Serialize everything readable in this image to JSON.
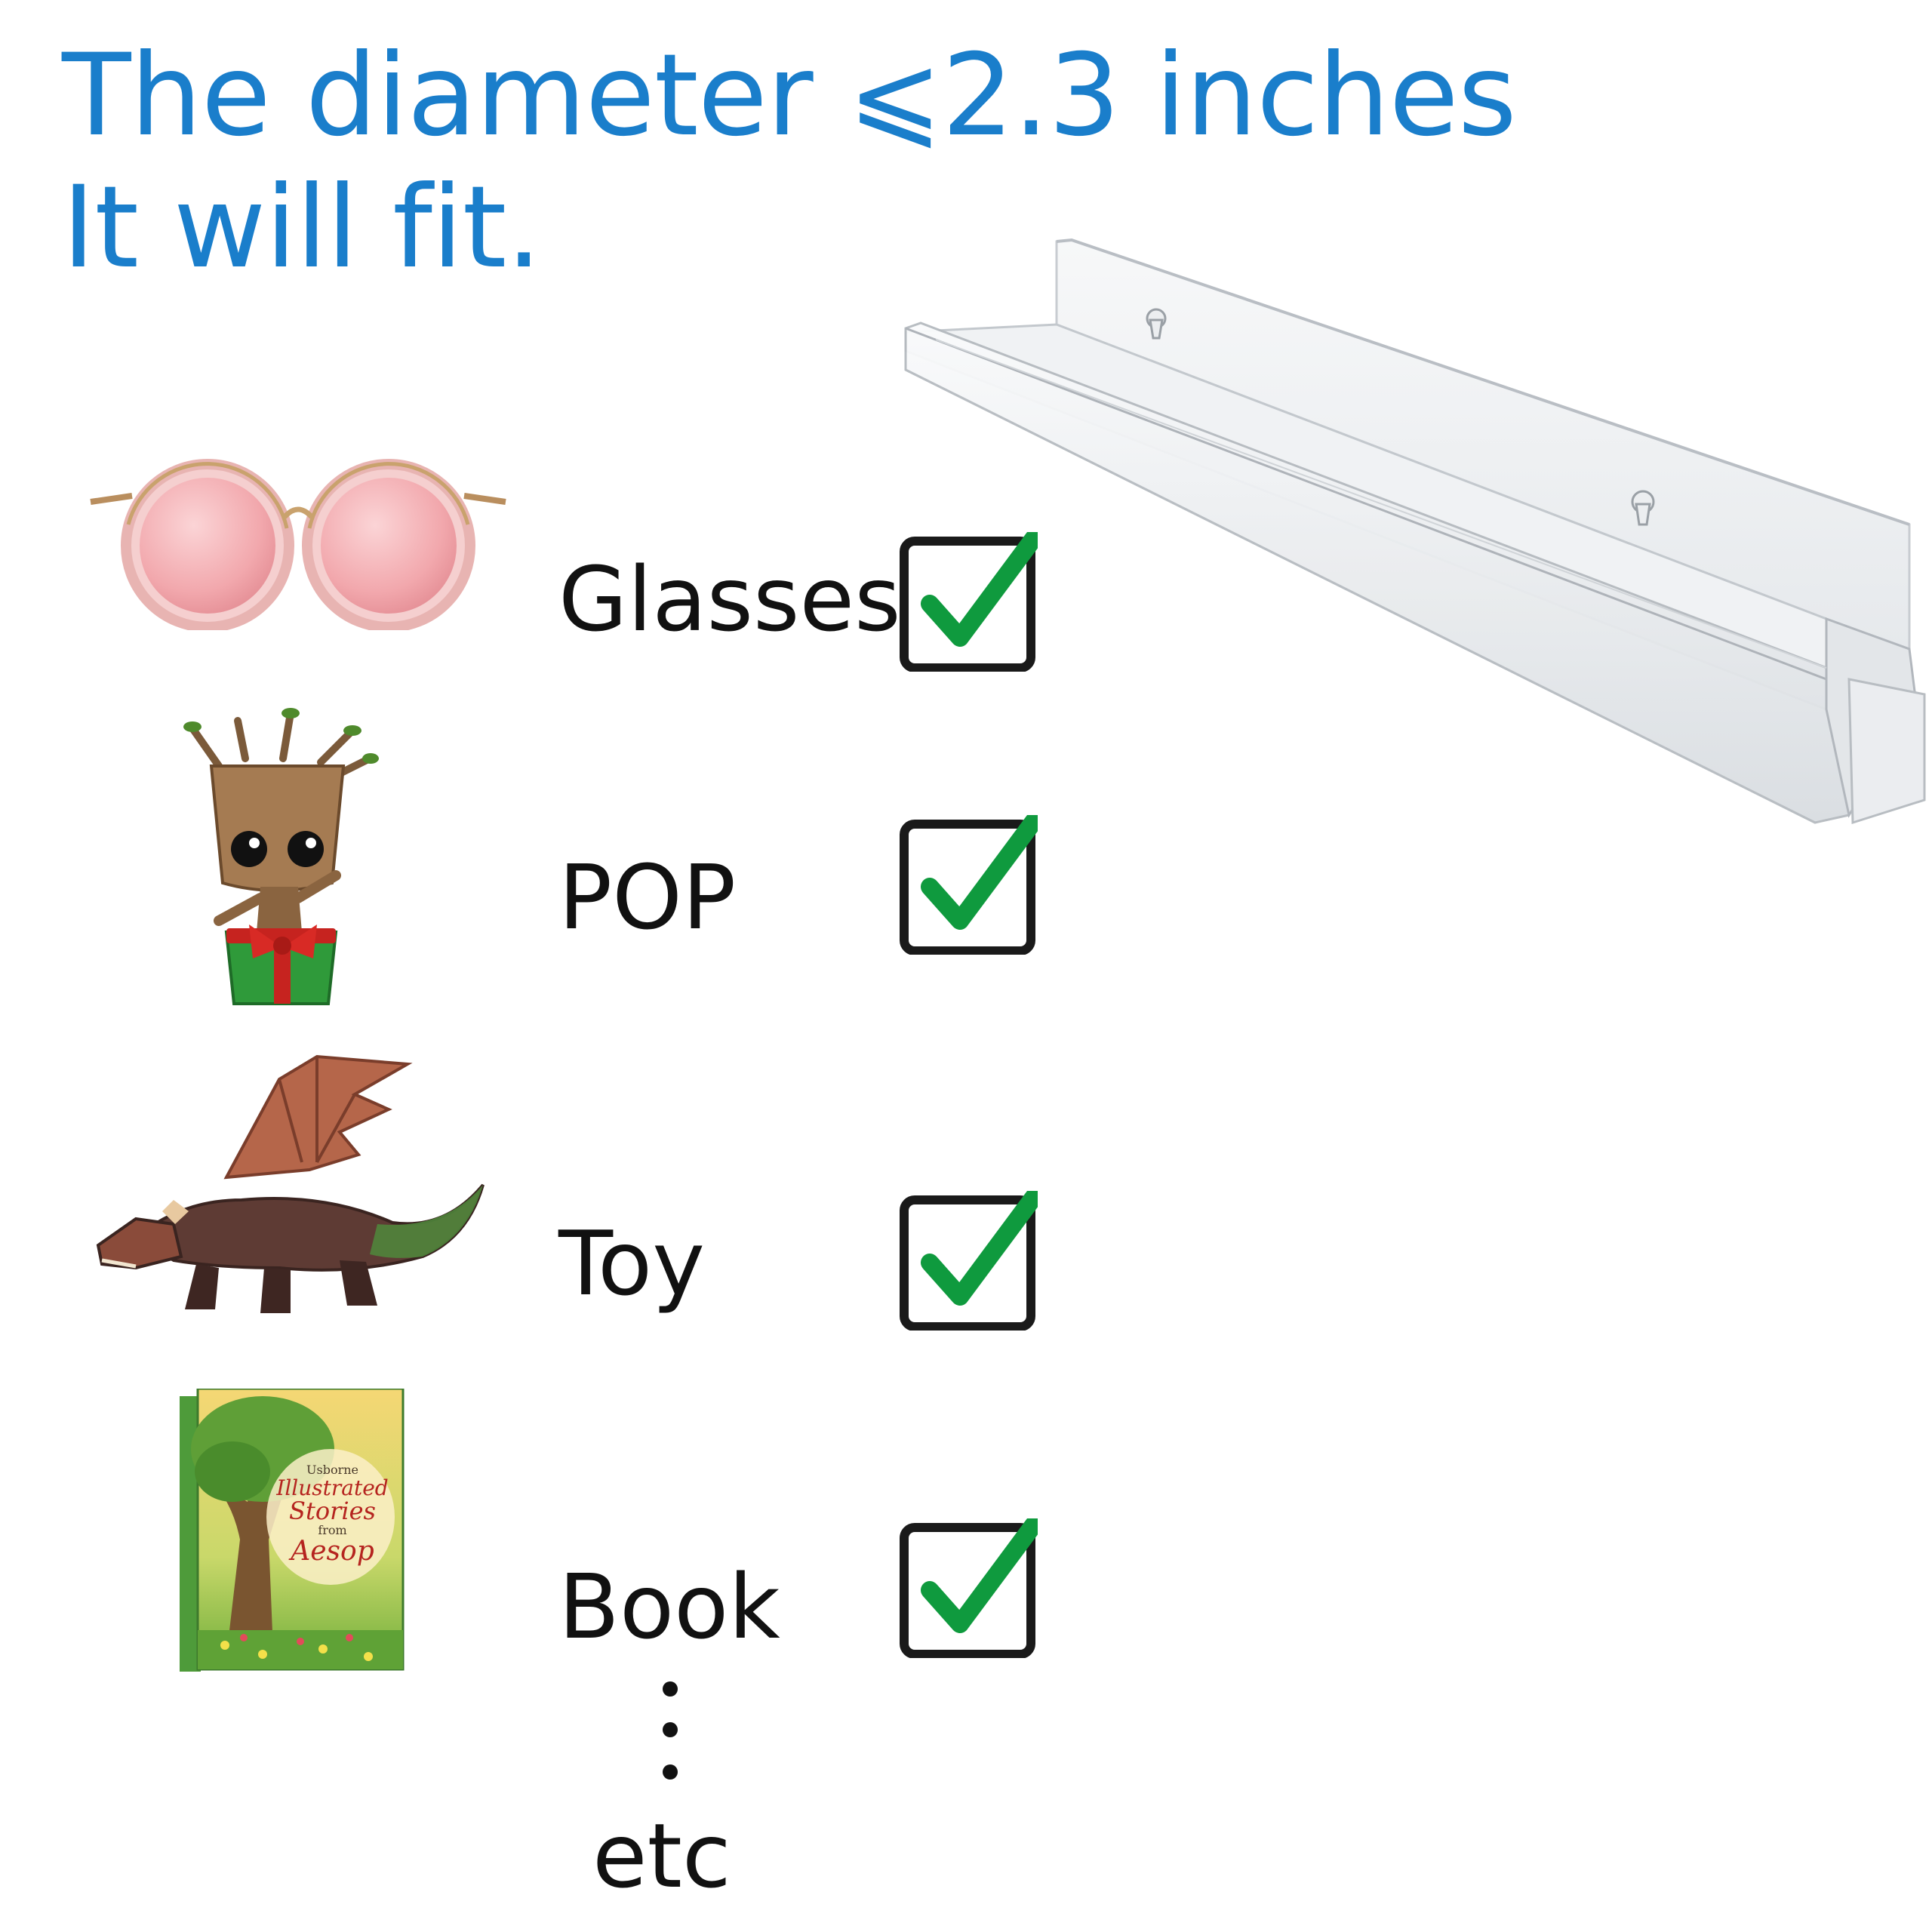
{
  "headline": {
    "line1": "The diameter  ⩽2.3 inches",
    "line2": "It will fit."
  },
  "items": [
    {
      "label": "Glasses",
      "checked": true,
      "icon": "sunglasses-icon"
    },
    {
      "label": "POP",
      "checked": true,
      "icon": "pop-figure-icon"
    },
    {
      "label": "Toy",
      "checked": true,
      "icon": "dragon-toy-icon"
    },
    {
      "label": "Book",
      "checked": true,
      "icon": "book-icon"
    }
  ],
  "book_cover": {
    "line1": "Usborne",
    "line2": "Illustrated",
    "line3": "Stories",
    "line4": "from",
    "line5": "Aesop"
  },
  "etc_label": "etc",
  "colors": {
    "headline": "#1a7ecb",
    "check_mark": "#0f9a3e",
    "box_border": "#1a1a1a"
  }
}
